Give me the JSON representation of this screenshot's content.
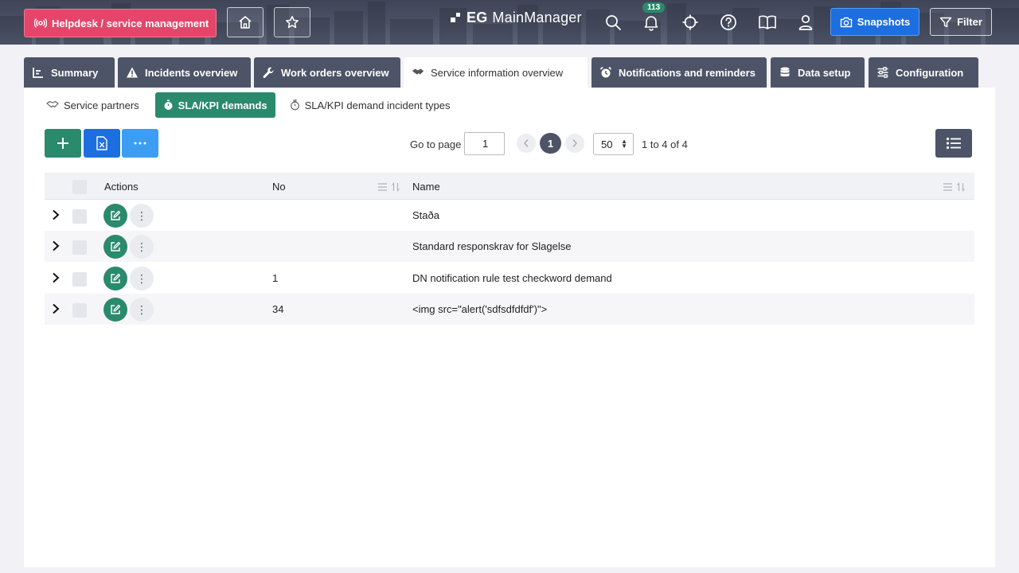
{
  "header": {
    "app_label": "Helpdesk / service management",
    "brand_prefix": "EG",
    "brand_name": "MainManager",
    "notifications_count": "113",
    "snapshots_label": "Snapshots",
    "filter_label": "Filter"
  },
  "tabs": [
    {
      "label": "Summary",
      "icon": "chart-bar-icon"
    },
    {
      "label": "Incidents overview",
      "icon": "warning-icon"
    },
    {
      "label": "Work orders overview",
      "icon": "wrench-icon"
    },
    {
      "label": "Service information overview",
      "icon": "handshake-icon",
      "active": true
    },
    {
      "label": "Notifications and reminders",
      "icon": "alarm-clock-icon"
    },
    {
      "label": "Data setup",
      "icon": "database-icon"
    },
    {
      "label": "Configuration",
      "icon": "sliders-icon"
    }
  ],
  "subtabs": [
    {
      "label": "Service partners",
      "icon": "handshake-icon"
    },
    {
      "label": "SLA/KPI demands",
      "icon": "stopwatch-icon",
      "active": true
    },
    {
      "label": "SLA/KPI demand incident types",
      "icon": "stopwatch-icon"
    }
  ],
  "pager": {
    "goto_label": "Go to page",
    "goto_value": "1",
    "current_page": "1",
    "page_size": "50",
    "range_text": "1 to 4 of 4"
  },
  "table": {
    "columns": {
      "actions": "Actions",
      "no": "No",
      "name": "Name"
    },
    "rows": [
      {
        "no": "",
        "name": "Staða"
      },
      {
        "no": "",
        "name": "Standard responskrav for Slagelse"
      },
      {
        "no": "1",
        "name": "DN notification rule test checkword demand"
      },
      {
        "no": "34",
        "name": "<img src=\"alert('sdfsdfdfdf')\">"
      }
    ]
  },
  "colors": {
    "accent_pink": "#e6456b",
    "accent_green": "#2a8a6b",
    "accent_blue": "#1d6fe0",
    "tab_dark": "#4d5467"
  }
}
